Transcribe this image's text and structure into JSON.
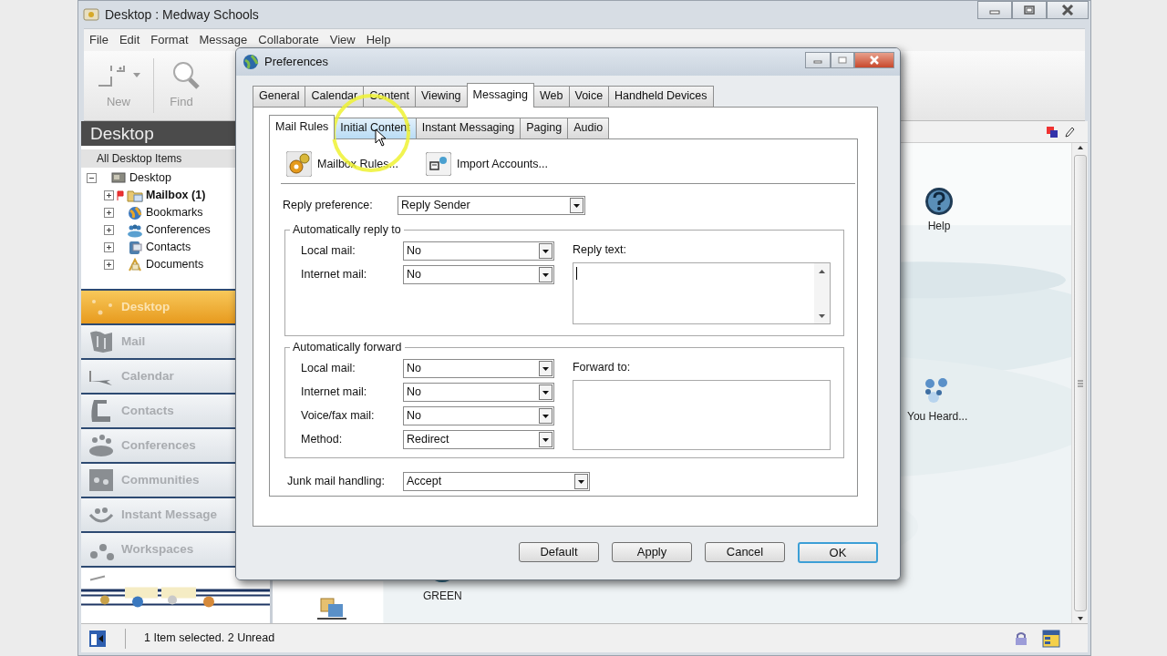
{
  "window": {
    "title": "Desktop : Medway Schools"
  },
  "menu": [
    "File",
    "Edit",
    "Format",
    "Message",
    "Collaborate",
    "View",
    "Help"
  ],
  "toolbar": [
    {
      "label": "New",
      "kind": "new"
    },
    {
      "label": "Find",
      "kind": "find"
    }
  ],
  "sidebar": {
    "header": "Desktop",
    "subheader": "All Desktop Items",
    "tree": [
      {
        "label": "Desktop",
        "kind": "desktop",
        "expanded": true,
        "children": [
          {
            "label": "Mailbox",
            "count": "(1)",
            "kind": "mailbox",
            "flagged": true,
            "unread": true,
            "expanded": false
          },
          {
            "label": "Bookmarks",
            "kind": "globe",
            "flagged": false,
            "unread": false,
            "expanded": false
          },
          {
            "label": "Conferences",
            "kind": "people",
            "flagged": false,
            "unread": false,
            "expanded": false
          },
          {
            "label": "Contacts",
            "kind": "card",
            "flagged": false,
            "unread": false,
            "expanded": false
          },
          {
            "label": "Documents",
            "kind": "docs",
            "flagged": false,
            "unread": false,
            "expanded": false
          }
        ]
      }
    ],
    "nav": [
      {
        "label": "Desktop",
        "kind": "desktop",
        "selected": true
      },
      {
        "label": "Mail",
        "kind": "mail",
        "selected": false
      },
      {
        "label": "Calendar",
        "kind": "calendar",
        "selected": false
      },
      {
        "label": "Contacts",
        "kind": "contacts",
        "selected": false
      },
      {
        "label": "Conferences",
        "kind": "conferences",
        "selected": false
      },
      {
        "label": "Communities",
        "kind": "communities",
        "selected": false
      },
      {
        "label": "Instant Message",
        "kind": "im",
        "selected": false
      },
      {
        "label": "Workspaces",
        "kind": "workspaces",
        "selected": false
      }
    ]
  },
  "content": {
    "items": [
      {
        "label": "Help",
        "kind": "help"
      },
      {
        "label": "You Heard...",
        "kind": "heard"
      },
      {
        "label": "GREEN",
        "kind": "green"
      },
      {
        "kind": "package"
      }
    ]
  },
  "status_bar": {
    "text": "1 Item selected. 2 Unread"
  },
  "dialog": {
    "title": "Preferences",
    "tabs": [
      {
        "label": "General",
        "selected": false
      },
      {
        "label": "Calendar",
        "selected": false
      },
      {
        "label": "Content",
        "selected": false
      },
      {
        "label": "Viewing",
        "selected": false
      },
      {
        "label": "Messaging",
        "selected": true
      },
      {
        "label": "Web",
        "selected": false
      },
      {
        "label": "Voice",
        "selected": false
      },
      {
        "label": "Handheld Devices",
        "selected": false
      }
    ],
    "subtabs": [
      {
        "label": "Mail Rules",
        "selected": true,
        "hot": false
      },
      {
        "label": "Initial Content",
        "selected": false,
        "hot": true
      },
      {
        "label": "Instant Messaging",
        "selected": false,
        "hot": false
      },
      {
        "label": "Paging",
        "selected": false,
        "hot": false
      },
      {
        "label": "Audio",
        "selected": false,
        "hot": false
      }
    ],
    "actions": [
      {
        "label": "Mailbox Rules...",
        "kind": "rules"
      },
      {
        "label": "Import Accounts...",
        "kind": "import"
      }
    ],
    "reply_preference": {
      "label": "Reply preference:",
      "value": "Reply Sender"
    },
    "auto_reply": {
      "title": "Automatically reply to",
      "fields": [
        {
          "label": "Local mail:",
          "value": "No"
        },
        {
          "label": "Internet mail:",
          "value": "No"
        }
      ],
      "text_label": "Reply text:",
      "text_focused": true
    },
    "auto_forward": {
      "title": "Automatically forward",
      "fields": [
        {
          "label": "Local mail:",
          "value": "No"
        },
        {
          "label": "Internet mail:",
          "value": "No"
        },
        {
          "label": "Voice/fax mail:",
          "value": "No"
        },
        {
          "label": "Method:",
          "value": "Redirect"
        }
      ],
      "text_label": "Forward to:",
      "text_focused": false
    },
    "junk": {
      "label": "Junk mail handling:",
      "value": "Accept"
    },
    "buttons": [
      {
        "label": "Default",
        "default": false
      },
      {
        "label": "Apply",
        "default": false
      },
      {
        "label": "Cancel",
        "default": false
      },
      {
        "label": "OK",
        "default": true
      }
    ]
  }
}
